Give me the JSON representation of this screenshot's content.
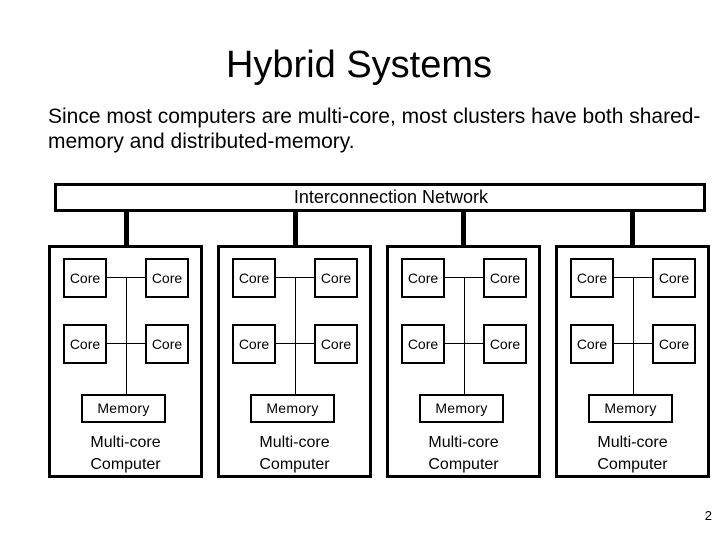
{
  "slide": {
    "title": "Hybrid Systems",
    "subtitle": "Since most computers are multi-core, most clusters have both shared-memory and distributed-memory.",
    "page_number": "2"
  },
  "diagram": {
    "network_label": "Interconnection Network",
    "computers": [
      {
        "cores": [
          "Core",
          "Core",
          "Core",
          "Core"
        ],
        "memory": "Memory",
        "label_line1": "Multi-core",
        "label_line2": "Computer"
      },
      {
        "cores": [
          "Core",
          "Core",
          "Core",
          "Core"
        ],
        "memory": "Memory",
        "label_line1": "Multi-core",
        "label_line2": "Computer"
      },
      {
        "cores": [
          "Core",
          "Core",
          "Core",
          "Core"
        ],
        "memory": "Memory",
        "label_line1": "Multi-core",
        "label_line2": "Computer"
      },
      {
        "cores": [
          "Core",
          "Core",
          "Core",
          "Core"
        ],
        "memory": "Memory",
        "label_line1": "Multi-core",
        "label_line2": "Computer"
      }
    ]
  }
}
